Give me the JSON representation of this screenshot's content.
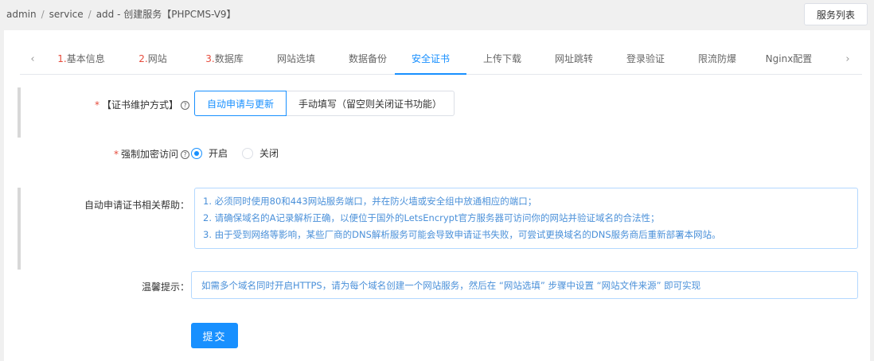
{
  "breadcrumb": {
    "items": [
      "admin",
      "service",
      "add - 创建服务【PHPCMS-V9】"
    ],
    "separator": "/"
  },
  "header": {
    "list_button": "服务列表"
  },
  "tabs": [
    {
      "num": "1.",
      "label": "基本信息"
    },
    {
      "num": "2.",
      "label": "网站"
    },
    {
      "num": "3.",
      "label": "数据库"
    },
    {
      "num": "",
      "label": "网站选填"
    },
    {
      "num": "",
      "label": "数据备份"
    },
    {
      "num": "",
      "label": "安全证书",
      "active": true
    },
    {
      "num": "",
      "label": "上传下载"
    },
    {
      "num": "",
      "label": "网址跳转"
    },
    {
      "num": "",
      "label": "登录验证"
    },
    {
      "num": "",
      "label": "限流防爆"
    },
    {
      "num": "",
      "label": "Nginx配置"
    }
  ],
  "icons": {
    "tab_prev": "chevron-left-icon",
    "tab_next": "chevron-right-icon",
    "help": "question-circle-icon"
  },
  "form": {
    "cert_mode": {
      "required_mark": "*",
      "label": "【证书维护方式】",
      "help_glyph": "?",
      "options": [
        "自动申请与更新",
        "手动填写（留空则关闭证书功能）"
      ],
      "selected": "自动申请与更新"
    },
    "force_https": {
      "required_mark": "*",
      "label": "强制加密访问",
      "help_glyph": "?",
      "options": [
        "开启",
        "关闭"
      ],
      "selected": "开启"
    },
    "help": {
      "label": "自动申请证书相关帮助：",
      "lines": [
        "1. 必须同时使用80和443网站服务端口，并在防火墙或安全组中放通相应的端口；",
        "2. 请确保域名的A记录解析正确，以便位于国外的LetsEncrypt官方服务器可访问你的网站并验证域名的合法性；",
        "3. 由于受到网络等影响，某些厂商的DNS解析服务可能会导致申请证书失败，可尝试更换域名的DNS服务商后重新部署本网站。"
      ]
    },
    "tip": {
      "label": "温馨提示：",
      "text": "如需多个域名同时开启HTTPS，请为每个域名创建一个网站服务，然后在 “网站选填” 步骤中设置 “网站文件来源” 即可实现"
    },
    "submit_label": "提交"
  },
  "colors": {
    "accent": "#1890ff",
    "required": "#e64b3c",
    "help_text": "#4a90d9"
  }
}
